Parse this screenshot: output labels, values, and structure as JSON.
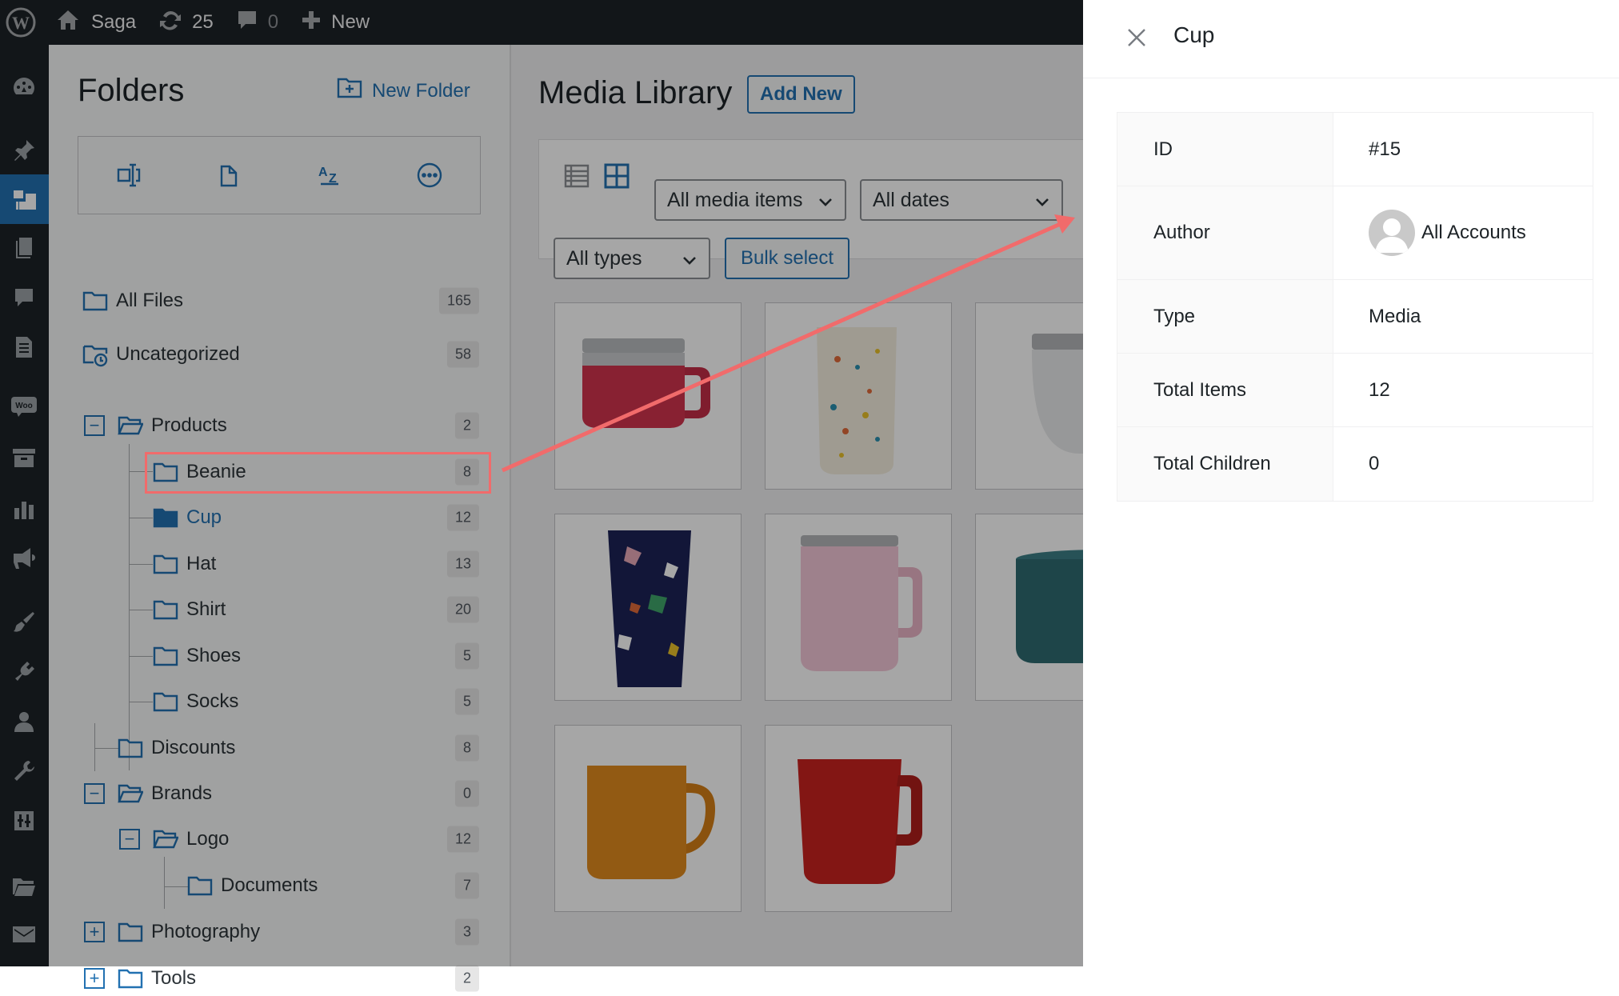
{
  "adminbar": {
    "site_name": "Saga",
    "updates_count": "25",
    "comments_count": "0",
    "new_label": "New"
  },
  "folders": {
    "title": "Folders",
    "new_folder_label": "New Folder",
    "items": [
      {
        "label": "All Files",
        "count": "165"
      },
      {
        "label": "Uncategorized",
        "count": "58"
      },
      {
        "label": "Products",
        "count": "2"
      },
      {
        "label": "Beanie",
        "count": "8"
      },
      {
        "label": "Cup",
        "count": "12"
      },
      {
        "label": "Hat",
        "count": "13"
      },
      {
        "label": "Shirt",
        "count": "20"
      },
      {
        "label": "Shoes",
        "count": "5"
      },
      {
        "label": "Socks",
        "count": "5"
      },
      {
        "label": "Discounts",
        "count": "8"
      },
      {
        "label": "Brands",
        "count": "0"
      },
      {
        "label": "Logo",
        "count": "12"
      },
      {
        "label": "Documents",
        "count": "7"
      },
      {
        "label": "Photography",
        "count": "3"
      },
      {
        "label": "Tools",
        "count": "2"
      }
    ]
  },
  "media": {
    "title": "Media Library",
    "add_new_label": "Add New",
    "filter_items": "All media items",
    "filter_dates": "All dates",
    "filter_types": "All types",
    "bulk_select_label": "Bulk select"
  },
  "panel": {
    "title": "Cup",
    "rows": [
      {
        "key": "ID",
        "value": "#15"
      },
      {
        "key": "Author",
        "value": "All Accounts"
      },
      {
        "key": "Type",
        "value": "Media"
      },
      {
        "key": "Total Items",
        "value": "12"
      },
      {
        "key": "Total Children",
        "value": "0"
      }
    ]
  },
  "colors": {
    "accent": "#2271b1",
    "highlight": "#f16b6b",
    "adminbar": "#1d2327"
  }
}
